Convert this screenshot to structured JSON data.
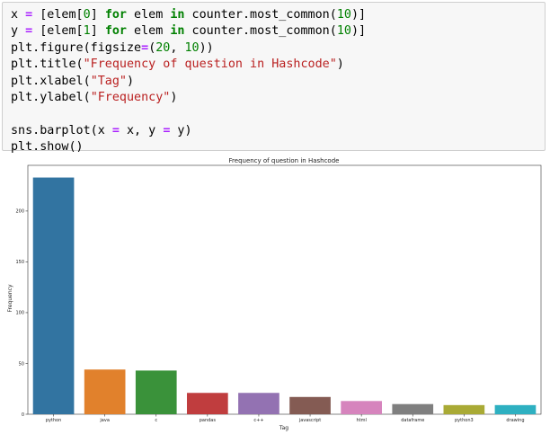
{
  "code_cell": {
    "lines": [
      [
        {
          "t": "x "
        },
        {
          "t": "=",
          "c": "op"
        },
        {
          "t": " [elem["
        },
        {
          "t": "0",
          "c": "num"
        },
        {
          "t": "] "
        },
        {
          "t": "for",
          "c": "kw"
        },
        {
          "t": " elem "
        },
        {
          "t": "in",
          "c": "kw"
        },
        {
          "t": " counter.most_common("
        },
        {
          "t": "10",
          "c": "num"
        },
        {
          "t": ")]"
        }
      ],
      [
        {
          "t": "y "
        },
        {
          "t": "=",
          "c": "op"
        },
        {
          "t": " [elem["
        },
        {
          "t": "1",
          "c": "num"
        },
        {
          "t": "] "
        },
        {
          "t": "for",
          "c": "kw"
        },
        {
          "t": " elem "
        },
        {
          "t": "in",
          "c": "kw"
        },
        {
          "t": " counter.most_common("
        },
        {
          "t": "10",
          "c": "num"
        },
        {
          "t": ")]"
        }
      ],
      [
        {
          "t": "plt.figure(figsize"
        },
        {
          "t": "=",
          "c": "op"
        },
        {
          "t": "("
        },
        {
          "t": "20",
          "c": "num"
        },
        {
          "t": ", "
        },
        {
          "t": "10",
          "c": "num"
        },
        {
          "t": "))"
        }
      ],
      [
        {
          "t": "plt.title("
        },
        {
          "t": "\"Frequency of question in Hashcode\"",
          "c": "str"
        },
        {
          "t": ")"
        }
      ],
      [
        {
          "t": "plt.xlabel("
        },
        {
          "t": "\"Tag\"",
          "c": "str"
        },
        {
          "t": ")"
        }
      ],
      [
        {
          "t": "plt.ylabel("
        },
        {
          "t": "\"Frequency\"",
          "c": "str"
        },
        {
          "t": ")"
        }
      ],
      [],
      [
        {
          "t": "sns.barplot(x "
        },
        {
          "t": "=",
          "c": "op"
        },
        {
          "t": " x, y "
        },
        {
          "t": "=",
          "c": "op"
        },
        {
          "t": " y)"
        }
      ],
      [
        {
          "t": "plt.show()"
        }
      ]
    ]
  },
  "chart_data": {
    "type": "bar",
    "title": "Frequency of question in Hashcode",
    "xlabel": "Tag",
    "ylabel": "Frequency",
    "categories": [
      "python",
      "java",
      "c",
      "pandas",
      "c++",
      "javascript",
      "html",
      "dataframe",
      "python3",
      "drawing"
    ],
    "values": [
      233,
      44,
      43,
      21,
      21,
      17,
      13,
      10,
      9,
      9
    ],
    "yticks": [
      0,
      50,
      100,
      150,
      200
    ],
    "ylim": [
      0,
      245
    ],
    "colors": [
      "#3274a1",
      "#e1812c",
      "#3a923a",
      "#c03d3e",
      "#9372b2",
      "#845b53",
      "#d684bd",
      "#7f7f7f",
      "#a9aa35",
      "#2eb0c1"
    ],
    "grid": false,
    "legend": "none"
  }
}
